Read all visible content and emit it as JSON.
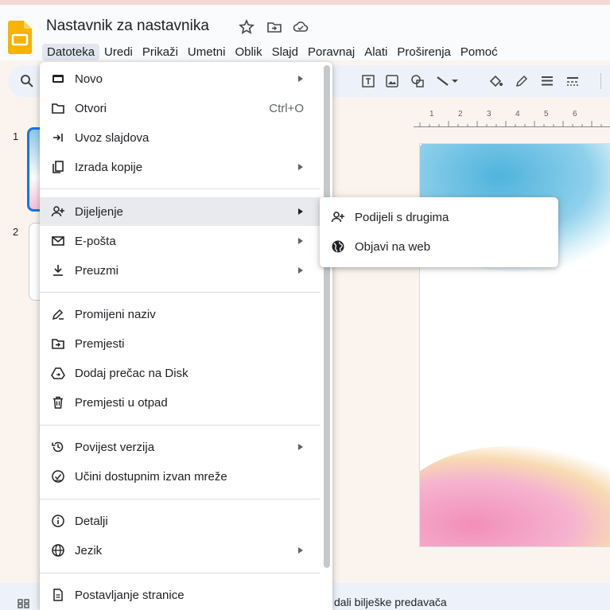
{
  "header": {
    "title": "Nastavnik za nastavnika",
    "menubar": [
      "Datoteka",
      "Uredi",
      "Prikaži",
      "Umetni",
      "Oblik",
      "Slajd",
      "Poravnaj",
      "Alati",
      "Proširenja",
      "Pomoć"
    ],
    "active_menu": "Datoteka"
  },
  "filmstrip": {
    "slide_numbers": [
      "1",
      "2"
    ]
  },
  "ruler": {
    "numbers": [
      "1",
      "2",
      "3",
      "4",
      "5",
      "6"
    ]
  },
  "file_menu": {
    "items": [
      {
        "label": "Novo",
        "icon": "slides-new-icon",
        "submenu": true
      },
      {
        "label": "Otvori",
        "icon": "folder-icon",
        "shortcut": "Ctrl+O"
      },
      {
        "label": "Uvoz slajdova",
        "icon": "import-icon"
      },
      {
        "label": "Izrada kopije",
        "icon": "copy-icon",
        "submenu": true
      },
      {
        "label": "Dijeljenje",
        "icon": "person-add-icon",
        "submenu": true,
        "highlighted": true
      },
      {
        "label": "E-pošta",
        "icon": "mail-icon",
        "submenu": true
      },
      {
        "label": "Preuzmi",
        "icon": "download-icon",
        "submenu": true
      },
      {
        "label": "Promijeni naziv",
        "icon": "rename-icon"
      },
      {
        "label": "Premjesti",
        "icon": "move-folder-icon"
      },
      {
        "label": "Dodaj prečac na Disk",
        "icon": "drive-shortcut-icon"
      },
      {
        "label": "Premjesti u otpad",
        "icon": "trash-icon"
      },
      {
        "label": "Povijest verzija",
        "icon": "history-icon",
        "submenu": true
      },
      {
        "label": "Učini dostupnim izvan mreže",
        "icon": "offline-icon"
      },
      {
        "label": "Detalji",
        "icon": "info-icon"
      },
      {
        "label": "Jezik",
        "icon": "globe-icon",
        "submenu": true
      },
      {
        "label": "Postavljanje stranice",
        "icon": "page-setup-icon"
      }
    ]
  },
  "share_submenu": {
    "items": [
      {
        "label": "Podijeli s drugima",
        "icon": "person-add-icon"
      },
      {
        "label": "Objavi na web",
        "icon": "public-globe-icon"
      }
    ]
  },
  "notes": {
    "placeholder_fragment": "dali bilješke predavača"
  },
  "colors": {
    "accent": "#1a73e8",
    "logo": "#f4b400",
    "menu_highlight": "#e8eaed"
  }
}
